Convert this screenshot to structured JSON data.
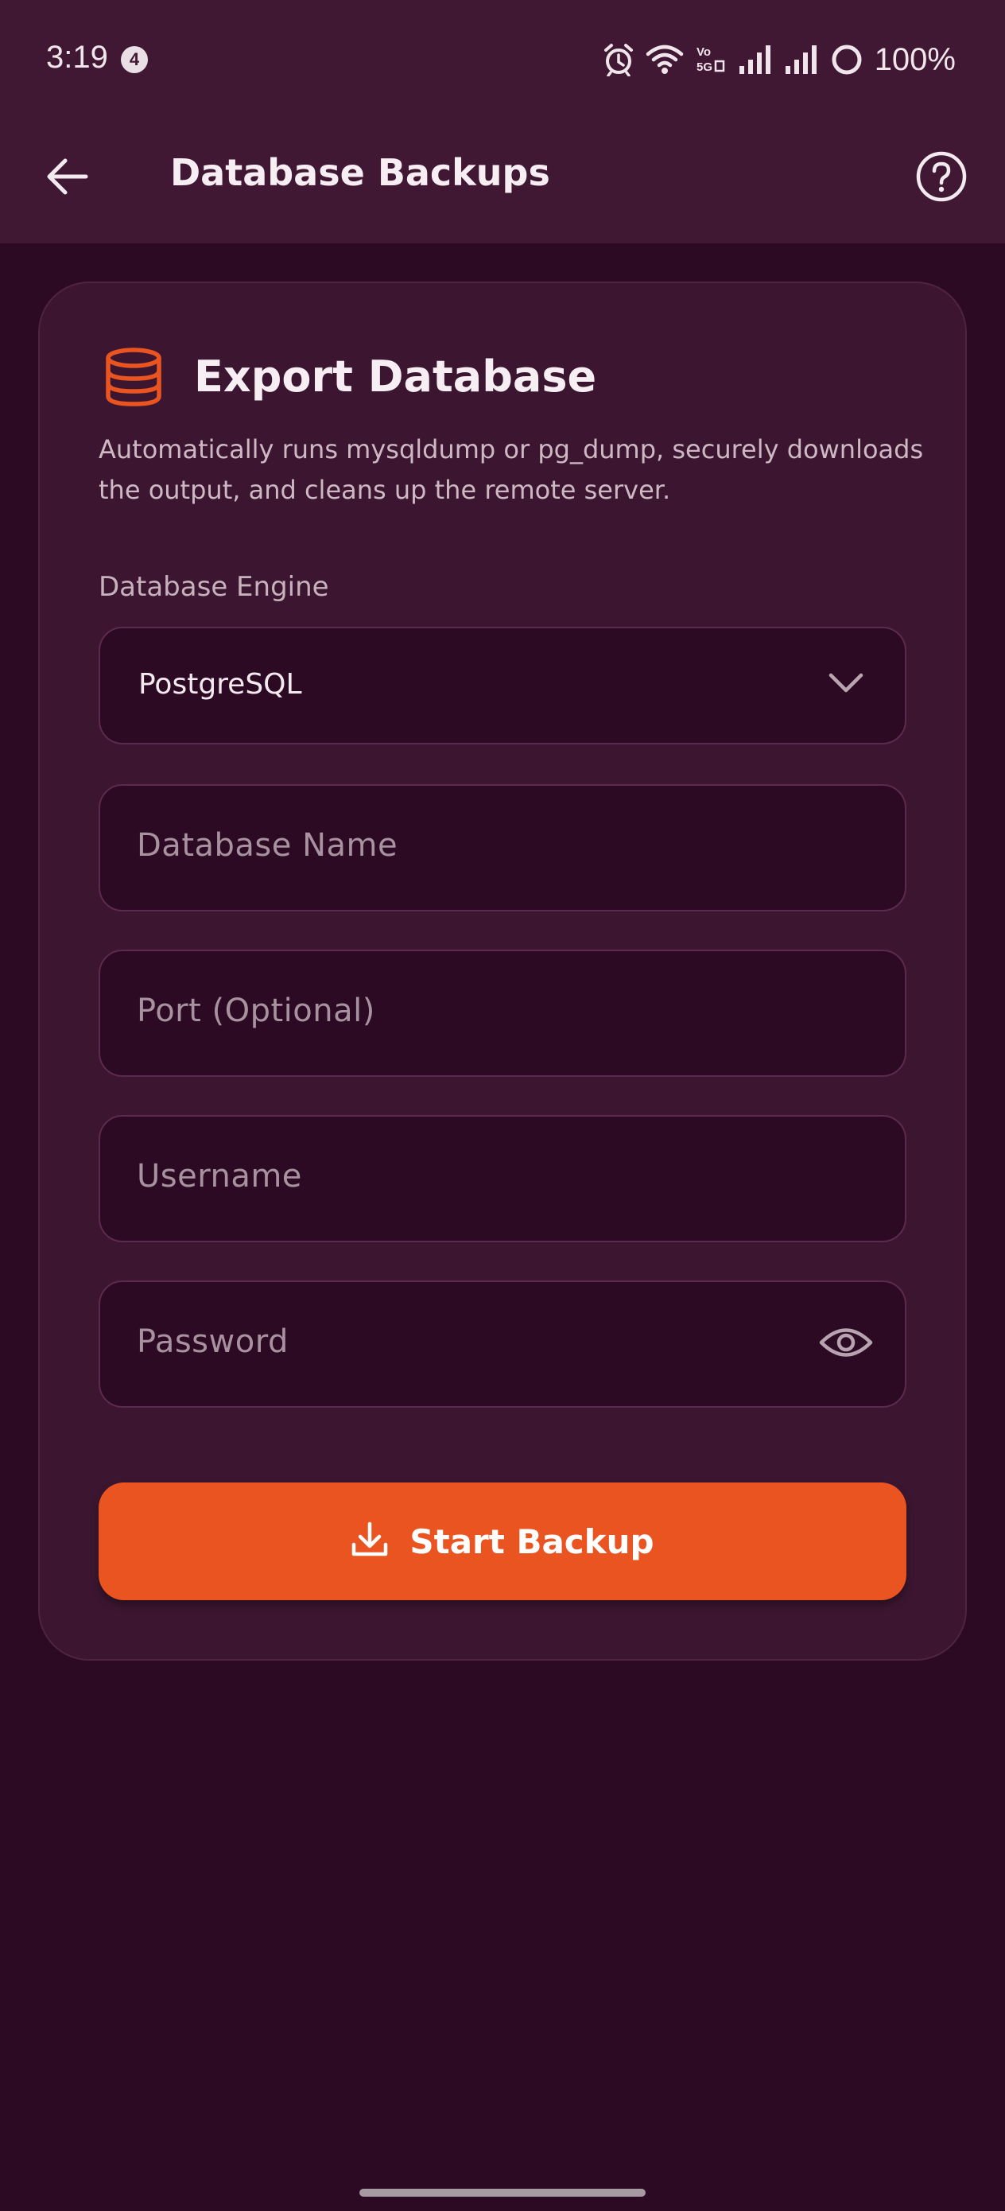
{
  "status_bar": {
    "time": "3:19",
    "notification_count": "4",
    "network_label": "Vo 5G",
    "battery": "100%"
  },
  "app_bar": {
    "title": "Database Backups",
    "back_icon": "arrow-left-icon",
    "help_icon": "help-circle-icon"
  },
  "card": {
    "icon": "database-icon",
    "title": "Export Database",
    "description": "Automatically runs mysqldump or pg_dump, securely downloads the output, and cleans up the remote server.",
    "engine_label": "Database Engine",
    "engine_value": "PostgreSQL",
    "fields": {
      "database_name": {
        "placeholder": "Database Name",
        "value": ""
      },
      "port": {
        "placeholder": "Port (Optional)",
        "value": ""
      },
      "username": {
        "placeholder": "Username",
        "value": ""
      },
      "password": {
        "placeholder": "Password",
        "value": ""
      }
    },
    "start_button": {
      "label": "Start Backup",
      "icon": "download-icon"
    }
  },
  "colors": {
    "accent": "#E95420",
    "background": "#2C0A23",
    "app_bar": "#411834",
    "card": "#3C1630"
  }
}
